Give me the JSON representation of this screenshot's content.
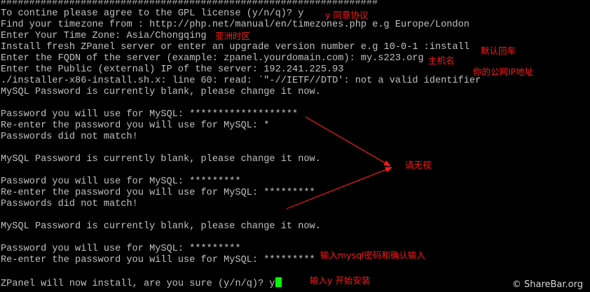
{
  "terminal": {
    "lines": [
      "##################################################################",
      "To contine please agree to the GPL license (y/n/q)? y",
      "Find your timezone from : http://php.net/manual/en/timezones.php e.g Europe/London",
      "Enter Your Time Zone: Asia/Chongqing",
      "Install fresh ZPanel server or enter an upgrade version number e.g 10-0-1 :install",
      "Enter the FQDN of the server (example: zpanel.yourdomain.com): my.s223.org",
      "Enter the Public (external) IP of the server: 192.241.225.93",
      "./installer-x86-install.sh.x: line 60: read: `\"-//IETF//DTD': not a valid identifier",
      "MySQL Password is currently blank, please change it now.",
      "",
      "Password you will use for MySQL: *******************",
      "Re-enter the password you will use for MySQL: *",
      "Passwords did not match!",
      "",
      "MySQL Password is currently blank, please change it now.",
      "",
      "Password you will use for MySQL: *********",
      "Re-enter the password you will use for MySQL: *********",
      "Passwords did not match!",
      "",
      "MySQL Password is currently blank, please change it now.",
      "",
      "Password you will use for MySQL: *********",
      "Re-enter the password you will use for MySQL: *********",
      "",
      "ZPanel will now install, are you sure (y/n/q)? y"
    ],
    "text_color": "#c0c0c0",
    "background_color": "#000000",
    "cursor_color": "#00ff00"
  },
  "annotations": {
    "agree": "y 同意协议",
    "timezone": "亚洲时区",
    "default_enter": "默认回车",
    "hostname": "主机名",
    "public_ip": "你的公网IP地址",
    "ignore": "请无视",
    "mysql_password": "输入mysql密码和确认输入",
    "start_install": "输入y 开始安装",
    "color": "#ff1a1a"
  },
  "watermark": {
    "text": "© ShareBar.org"
  }
}
